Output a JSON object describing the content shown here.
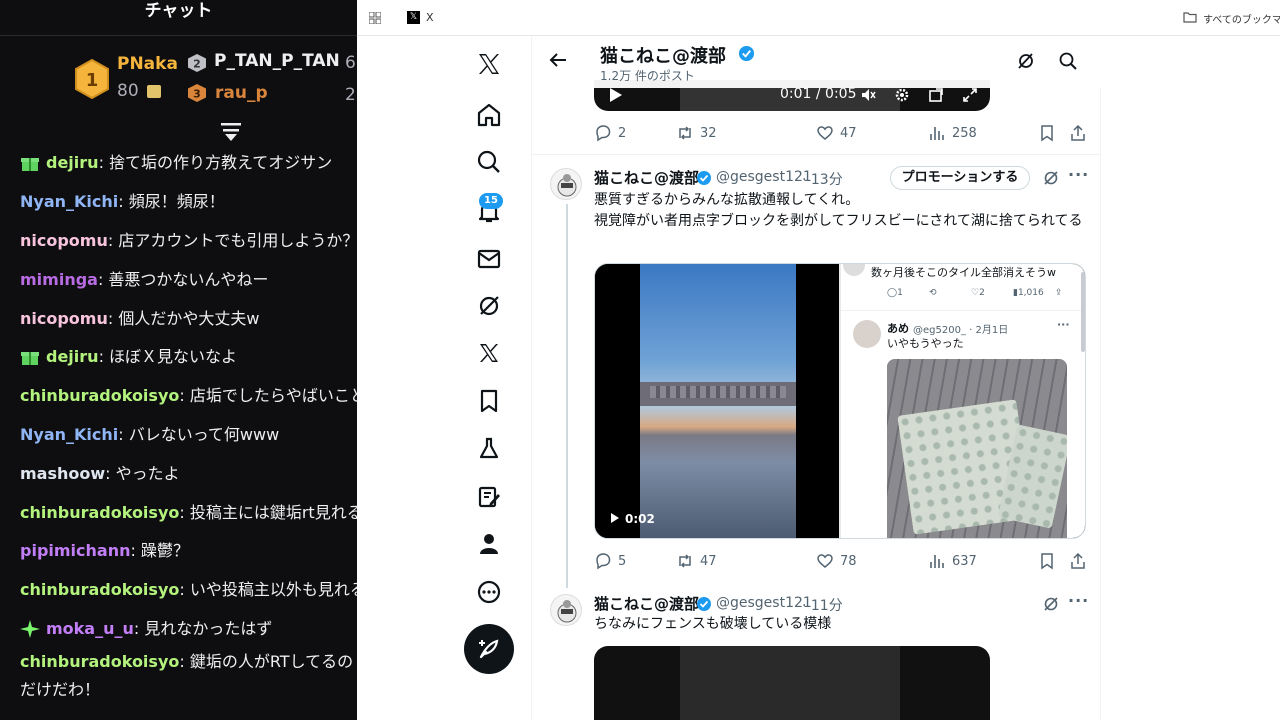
{
  "chat": {
    "title": "チャット",
    "leaderboard": {
      "first": {
        "rank": "1",
        "name": "PNaka",
        "value": "80"
      },
      "second": {
        "rank": "2",
        "name": "P_TAN_P_TAN",
        "value": "6"
      },
      "third": {
        "rank": "3",
        "name": "rau_p",
        "value": "2"
      }
    },
    "messages": [
      {
        "user": "dejiru",
        "text": ": 捨て垢の作り方教えてオジサン",
        "color": "#b3f27d",
        "badge": "gift"
      },
      {
        "user": "Nyan_Kichi",
        "text": ": 頻尿！頻尿！",
        "color": "#8fb5f5",
        "badge": ""
      },
      {
        "user": "nicopomu",
        "text": ": 店アカウントでも引用しようか？",
        "color": "#f8c4dd",
        "badge": ""
      },
      {
        "user": "miminga",
        "text": ": 善悪つかないんやねー",
        "color": "#b86be3",
        "badge": ""
      },
      {
        "user": "nicopomu",
        "text": ": 個人だかや大丈夫w",
        "color": "#f8c4dd",
        "badge": ""
      },
      {
        "user": "dejiru",
        "text": ": ほぼＸ見ないなよ",
        "color": "#b3f27d",
        "badge": "gift"
      },
      {
        "user": "chinburadokoisyo",
        "text": ": 店垢でしたらやばいこと",
        "color": "#b3f27d",
        "badge": ""
      },
      {
        "user": "Nyan_Kichi",
        "text": ": バレないって何www",
        "color": "#8fb5f5",
        "badge": ""
      },
      {
        "user": "mashoow",
        "text": ": やったよ",
        "color": "#dfe6ef",
        "badge": ""
      },
      {
        "user": "chinburadokoisyo",
        "text": ": 投稿主には鍵垢rt見れる",
        "color": "#b3f27d",
        "badge": ""
      },
      {
        "user": "pipimichann",
        "text": ": 躁鬱？",
        "color": "#c27ef7",
        "badge": ""
      },
      {
        "user": "chinburadokoisyo",
        "text": ": いや投稿主以外も見れる",
        "color": "#b3f27d",
        "badge": ""
      },
      {
        "user": "moka_u_u",
        "text": ": 見れなかったはず",
        "color": "#c27ef7",
        "badge": "sparkle"
      }
    ],
    "last_message": {
      "user": "chinburadokoisyo",
      "text": ": 鍵垢の人がRTしてるのだけだわ！",
      "color": "#b3f27d"
    }
  },
  "browser": {
    "tab_title": "X",
    "bookmarks_label": "すべてのブックマーク",
    "notifications_count": "15"
  },
  "header": {
    "title": "猫こねこ@渡部",
    "posts_count": "1.2万 件のポスト"
  },
  "video_top": {
    "time": "0:01 / 0:05"
  },
  "post0_actions": {
    "replies": "2",
    "reposts": "32",
    "likes": "47",
    "views": "258"
  },
  "post1": {
    "name": "猫こねこ@渡部",
    "handle": "@gesgest121",
    "time": "· 13分",
    "promote_label": "プロモーションする",
    "line1": "悪質すぎるからみんな拡散通報してくれ。",
    "line2": "視覚障がい者用点字ブロックを剥がしてフリスビーにされて湖に捨てられてる",
    "video_duration": "0:02",
    "embed": {
      "top_text": "数ヶ月後そこのタイル全部消えそうw",
      "replies": "1",
      "likes": "2",
      "views": "1,016",
      "name": "あめ",
      "handle": "@eg5200_ · 2月1日",
      "text": "いやもうやった"
    },
    "actions": {
      "replies": "5",
      "reposts": "47",
      "likes": "78",
      "views": "637"
    }
  },
  "post2": {
    "name": "猫こねこ@渡部",
    "handle": "@gesgest121",
    "time": "· 11分",
    "text": "ちなみにフェンスも破壊している模様"
  },
  "colors": {
    "x_blue": "#1d9bf0",
    "chat_bg": "#0e0e10",
    "gold": "#f5b43b"
  }
}
